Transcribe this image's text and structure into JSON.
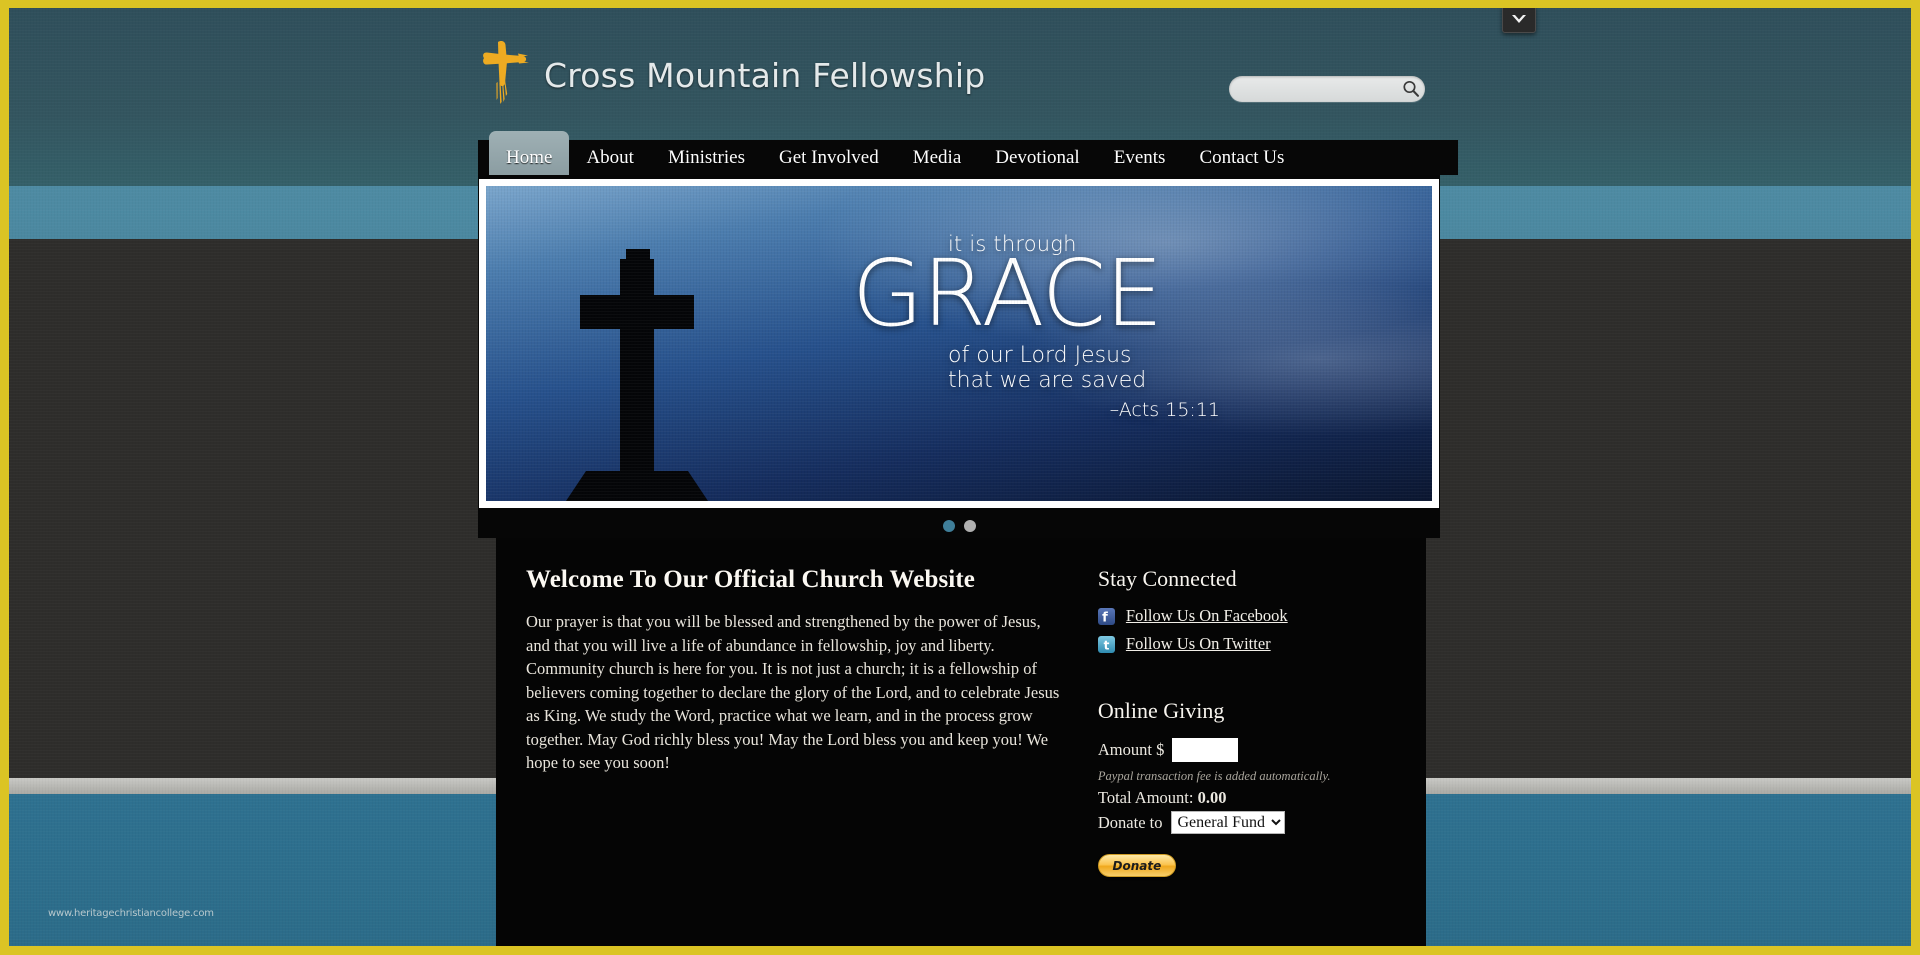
{
  "site": {
    "title": "Cross Mountain Fellowship",
    "logo_icon": "gold-brush-cross-icon",
    "watermark": "www.heritagechristiancollege.com"
  },
  "search": {
    "value": "",
    "placeholder": "",
    "icon": "magnifier-icon"
  },
  "nav": {
    "items": [
      {
        "label": "Home",
        "active": true
      },
      {
        "label": "About",
        "active": false
      },
      {
        "label": "Ministries",
        "active": false
      },
      {
        "label": "Get Involved",
        "active": false
      },
      {
        "label": "Media",
        "active": false
      },
      {
        "label": "Devotional",
        "active": false
      },
      {
        "label": "Events",
        "active": false
      },
      {
        "label": "Contact Us",
        "active": false
      }
    ]
  },
  "hero": {
    "line1": "it is through",
    "word": "GRACE",
    "line2": "of our Lord Jesus",
    "line3": "that we are saved",
    "reference": "–Acts 15:11",
    "image_icon": "cross-silhouette-sky-icon",
    "dots": [
      {
        "name": "slide-1",
        "active": true,
        "color": "#3f7e99"
      },
      {
        "name": "slide-2",
        "active": false,
        "color": "#b0b0b0"
      }
    ]
  },
  "main": {
    "heading": "Welcome To Our Official Church Website",
    "body": "Our prayer is that you will be blessed and strengthened by the power of Jesus, and that you will live a life of abundance in fellowship, joy and liberty. Community church is here for you. It is not just a church; it is a fellowship of believers coming together to declare the glory of the Lord, and to celebrate Jesus as King. We study the Word, practice what we learn, and in the process grow together. May God richly bless you! May the Lord bless you and keep you! We hope to see you soon!"
  },
  "sidebar": {
    "stay_connected": {
      "heading": "Stay Connected",
      "links": [
        {
          "label": "Follow Us On Facebook",
          "icon": "facebook-icon",
          "color": "#3b5998"
        },
        {
          "label": "Follow Us On Twitter",
          "icon": "twitter-icon",
          "color": "#4aa8c9"
        }
      ]
    },
    "online_giving": {
      "heading": "Online Giving",
      "amount_label": "Amount $",
      "amount_value": "",
      "paypal_note": "Paypal transaction fee is added automatically.",
      "total_label": "Total Amount:",
      "total_value": "0.00",
      "donate_to_label": "Donate to",
      "donate_to_selected": "General Fund",
      "donate_to_options": [
        "General Fund"
      ],
      "donate_button_label": "Donate"
    }
  },
  "browser": {
    "scroll_chip_icon": "chevron-down-icon"
  },
  "colors": {
    "frame": "#dbc424",
    "accent_gold": "#e8a81c",
    "panel": "#050505",
    "band_light": "#4e8ba3",
    "band_bottom": "#2e7190"
  }
}
